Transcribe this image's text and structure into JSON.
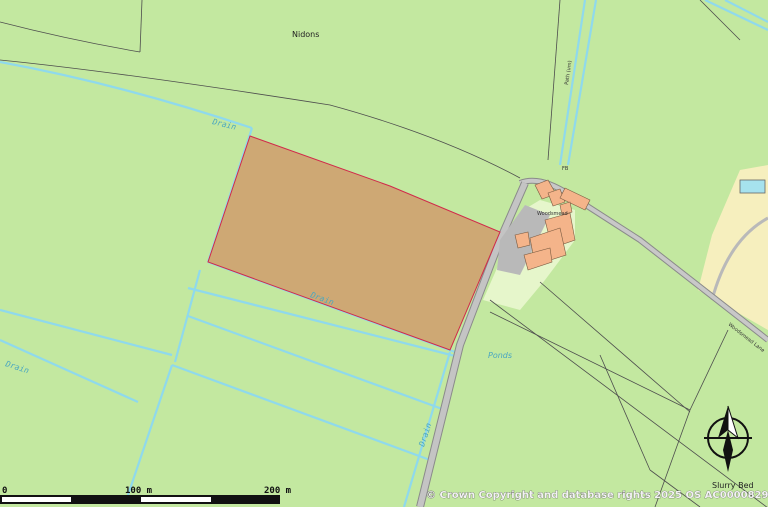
{
  "labels": {
    "nidons": "Nidons",
    "drain_1": "Drain",
    "drain_2": "Drain",
    "drain_3": "Drain",
    "drain_4": "Drain",
    "ponds": "Ponds",
    "path": "Path (um)",
    "fb": "FB",
    "farm": "Woodsmead",
    "lane": "Woodsmead Lane",
    "slurry": "Slurry Bed"
  },
  "scale_bar": {
    "label_0": "0",
    "label_100": "100 m",
    "label_200": "200 m"
  },
  "copyright": "© Crown Copyright and database rights 2025 OS AC0000829429",
  "colors": {
    "land": "#c3e8a0",
    "water": "#8fd9ec",
    "parcel": "#cea874",
    "parcel_outline": "#d02a4a",
    "road": "#b4b4b4",
    "building": "#f4b48a",
    "garden": "#e6f6cb",
    "site": "#f6efbe"
  },
  "icons": {
    "north_arrow": "north-arrow-icon",
    "pond": "pond-icon"
  }
}
